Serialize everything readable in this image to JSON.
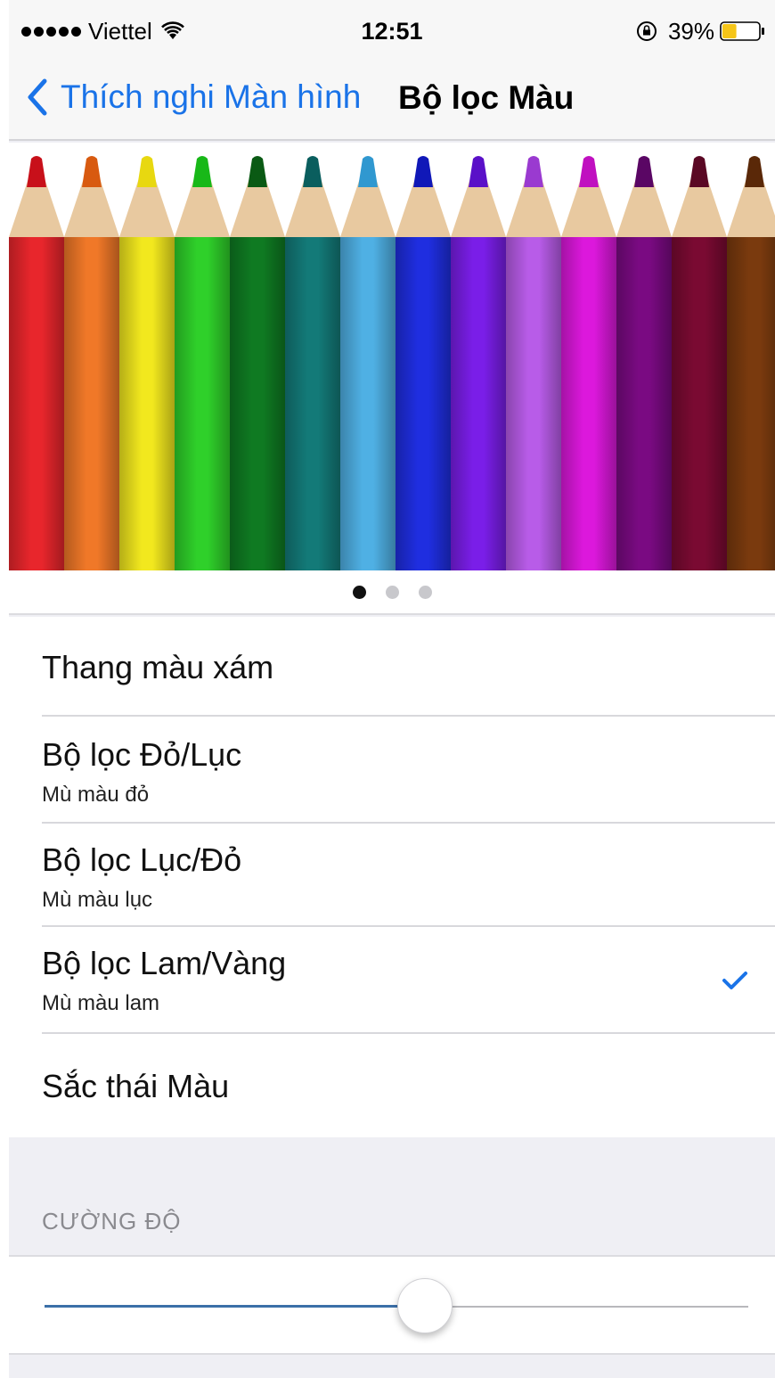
{
  "status_bar": {
    "carrier": "Viettel",
    "time": "12:51",
    "battery": "39%",
    "battery_level": 0.39
  },
  "nav": {
    "back_label": "Thích nghi Màn hình",
    "title": "Bộ lọc Màu"
  },
  "preview": {
    "page_count": 3,
    "current_page": 1,
    "pencil_colors": [
      "#e8262c",
      "#f07828",
      "#f2e81e",
      "#2fd02a",
      "#0f7a22",
      "#137a78",
      "#4fb0e4",
      "#1f2ee0",
      "#7a1ee8",
      "#b85ce8",
      "#dc18dc",
      "#7a0a82",
      "#7a0a32",
      "#7a3a0e"
    ],
    "tip_colors": [
      "#c8101a",
      "#d85a10",
      "#e8d810",
      "#18b818",
      "#0a5a14",
      "#0a5e5e",
      "#3098d0",
      "#1018b8",
      "#5a10c8",
      "#9a3ad0",
      "#c010c0",
      "#5a0664",
      "#5a0824",
      "#5a2808"
    ]
  },
  "filters": [
    {
      "title": "Thang màu xám",
      "subtitle": "",
      "selected": false
    },
    {
      "title": "Bộ lọc Đỏ/Lục",
      "subtitle": "Mù màu đỏ",
      "selected": false
    },
    {
      "title": "Bộ lọc Lục/Đỏ",
      "subtitle": "Mù màu lục",
      "selected": false
    },
    {
      "title": "Bộ lọc Lam/Vàng",
      "subtitle": "Mù màu lam",
      "selected": true
    },
    {
      "title": "Sắc thái Màu",
      "subtitle": "",
      "selected": false
    }
  ],
  "intensity": {
    "header": "CƯỜNG ĐỘ",
    "value": 0.54
  },
  "colors": {
    "accent": "#1a73e8",
    "battery_fill": "#f5c518"
  }
}
